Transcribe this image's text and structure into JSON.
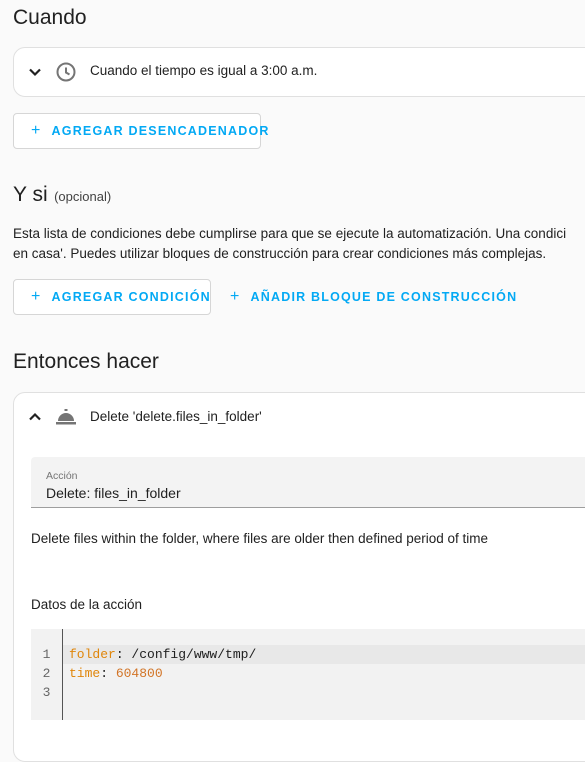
{
  "when": {
    "heading": "Cuando",
    "trigger_label": "Cuando el tiempo es igual a 3:00 a.m.",
    "add_trigger_label": "AGREGAR DESENCADENADOR"
  },
  "conditions": {
    "heading": "Y si",
    "optional_label": "(opcional)",
    "description_line1": "Esta lista de condiciones debe cumplirse para que se ejecute la automatización. Una condici",
    "description_line2": "en casa'. Puedes utilizar bloques de construcción para crear condiciones más complejas.",
    "add_condition_label": "AGREGAR CONDICIÓN",
    "add_building_block_label": "AÑADIR BLOQUE DE CONSTRUCCIÓN"
  },
  "actions": {
    "heading": "Entonces hacer",
    "action_title": "Delete 'delete.files_in_folder'",
    "action_field_label": "Acción",
    "action_field_value": "Delete: files_in_folder",
    "action_description": "Delete files within the folder, where files are older then defined period of time",
    "data_label": "Datos de la acción",
    "code": {
      "line_numbers": [
        "1",
        "2",
        "3"
      ],
      "line1_key": "folder",
      "line1_value": "/config/www/tmp/",
      "line2_key": "time",
      "line2_value": "604800",
      "separator": ": "
    }
  },
  "icons": [
    "chevron-down-icon",
    "clock-icon",
    "plus-icon",
    "chevron-up-icon",
    "service-bell-icon"
  ],
  "colors": {
    "accent": "#03a9f4",
    "yaml_key": "#e0860b"
  }
}
